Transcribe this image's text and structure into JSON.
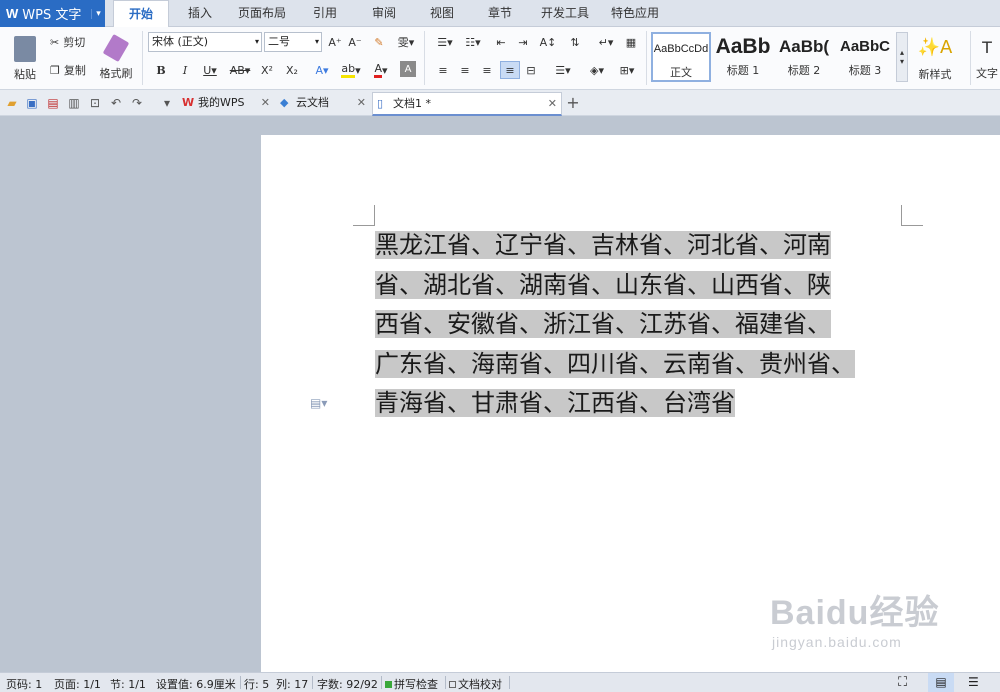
{
  "app": {
    "name": "WPS 文字"
  },
  "tabs": [
    "开始",
    "插入",
    "页面布局",
    "引用",
    "审阅",
    "视图",
    "章节",
    "开发工具",
    "特色应用"
  ],
  "ribbon": {
    "paste": "粘贴",
    "cut": "剪切",
    "copy": "复制",
    "format_painter": "格式刷",
    "font_name": "宋体 (正文)",
    "font_size": "二号",
    "styles": [
      {
        "sample": "AaBbCcDd",
        "label": "正文"
      },
      {
        "sample": "AaBb",
        "label": "标题 1"
      },
      {
        "sample": "AaBb(",
        "label": "标题 2"
      },
      {
        "sample": "AaBbC",
        "label": "标题 3"
      }
    ],
    "new_style": "新样式",
    "text_tools": "文字"
  },
  "doc_tabs": [
    {
      "label": "我的WPS"
    },
    {
      "label": "云文档"
    },
    {
      "label": "文档1 *"
    }
  ],
  "document": {
    "lines": [
      "黑龙江省、辽宁省、吉林省、河北省、河南",
      "省、湖北省、湖南省、山东省、山西省、陕",
      "西省、安徽省、浙江省、江苏省、福建省、",
      "广东省、海南省、四川省、云南省、贵州省、",
      "青海省、甘肃省、江西省、台湾省"
    ]
  },
  "status": {
    "page_num": "页码: 1",
    "pages": "页面: 1/1",
    "section": "节: 1/1",
    "setting": "设置值: 6.9厘米",
    "row": "行: 5",
    "col": "列: 17",
    "words": "字数: 92/92",
    "spell": "拼写检查",
    "proof": "文档校对"
  },
  "watermark": {
    "big": "Baidu经验",
    "small": "jingyan.baidu.com"
  },
  "colors": {
    "accent": "#2a6cc4",
    "selection": "#c8c8c8"
  }
}
